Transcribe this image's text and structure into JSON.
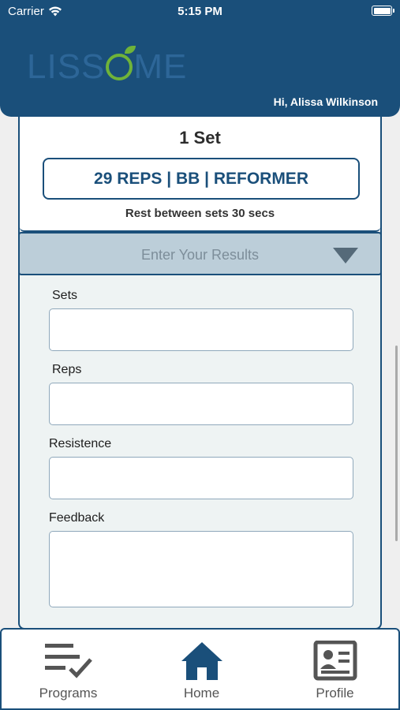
{
  "status_bar": {
    "carrier": "Carrier",
    "time": "5:15 PM"
  },
  "header": {
    "logo_text_left": "LISS",
    "logo_text_right": "ME",
    "greeting": "Hi, Alissa Wilkinson"
  },
  "exercise": {
    "set_title": "1 Set",
    "reps_summary": "29 REPS | BB | REFORMER",
    "rest": "Rest between sets 30 secs"
  },
  "results": {
    "dropdown_label": "Enter Your Results",
    "fields": {
      "sets_label": "Sets",
      "sets_value": "",
      "reps_label": "Reps",
      "reps_value": "",
      "resistance_label": "Resistence",
      "resistance_value": "",
      "feedback_label": "Feedback",
      "feedback_value": ""
    }
  },
  "tabbar": {
    "programs_label": "Programs",
    "programs_icon": "checklist-icon",
    "home_label": "Home",
    "home_icon": "home-icon",
    "profile_label": "Profile",
    "profile_icon": "profile-card-icon",
    "active": "home"
  },
  "colors": {
    "primary": "#1a4f7a",
    "accent_green": "#6fb339",
    "results_bar": "#bcced9"
  }
}
